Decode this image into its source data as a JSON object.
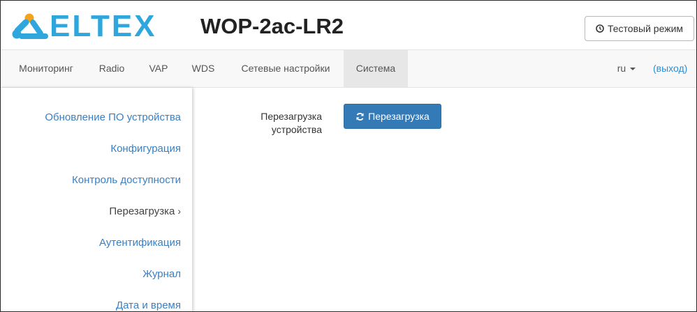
{
  "header": {
    "logo_text": "ELTEX",
    "device_title": "WOP-2ac-LR2",
    "test_mode_label": "Тестовый режим",
    "test_mode_icon": "clock-icon"
  },
  "nav": {
    "items": [
      {
        "label": "Мониторинг"
      },
      {
        "label": "Radio"
      },
      {
        "label": "VAP"
      },
      {
        "label": "WDS"
      },
      {
        "label": "Сетевые настройки"
      },
      {
        "label": "Система",
        "active": true
      }
    ],
    "language": "ru",
    "logout_label": "(выход)"
  },
  "sidebar": {
    "items": [
      {
        "label": "Обновление ПО устройства"
      },
      {
        "label": "Конфигурация"
      },
      {
        "label": "Контроль доступности"
      },
      {
        "label": "Перезагрузка",
        "current": true
      },
      {
        "label": "Аутентификация"
      },
      {
        "label": "Журнал"
      },
      {
        "label": "Дата и время"
      }
    ],
    "current_marker": "›"
  },
  "main": {
    "reboot_label": "Перезагрузка устройства",
    "reboot_button": "Перезагрузка",
    "reboot_icon": "refresh-icon"
  },
  "colors": {
    "brand": "#2fa7dc",
    "link": "#3a7fc1",
    "primary_button": "#337ab7"
  }
}
